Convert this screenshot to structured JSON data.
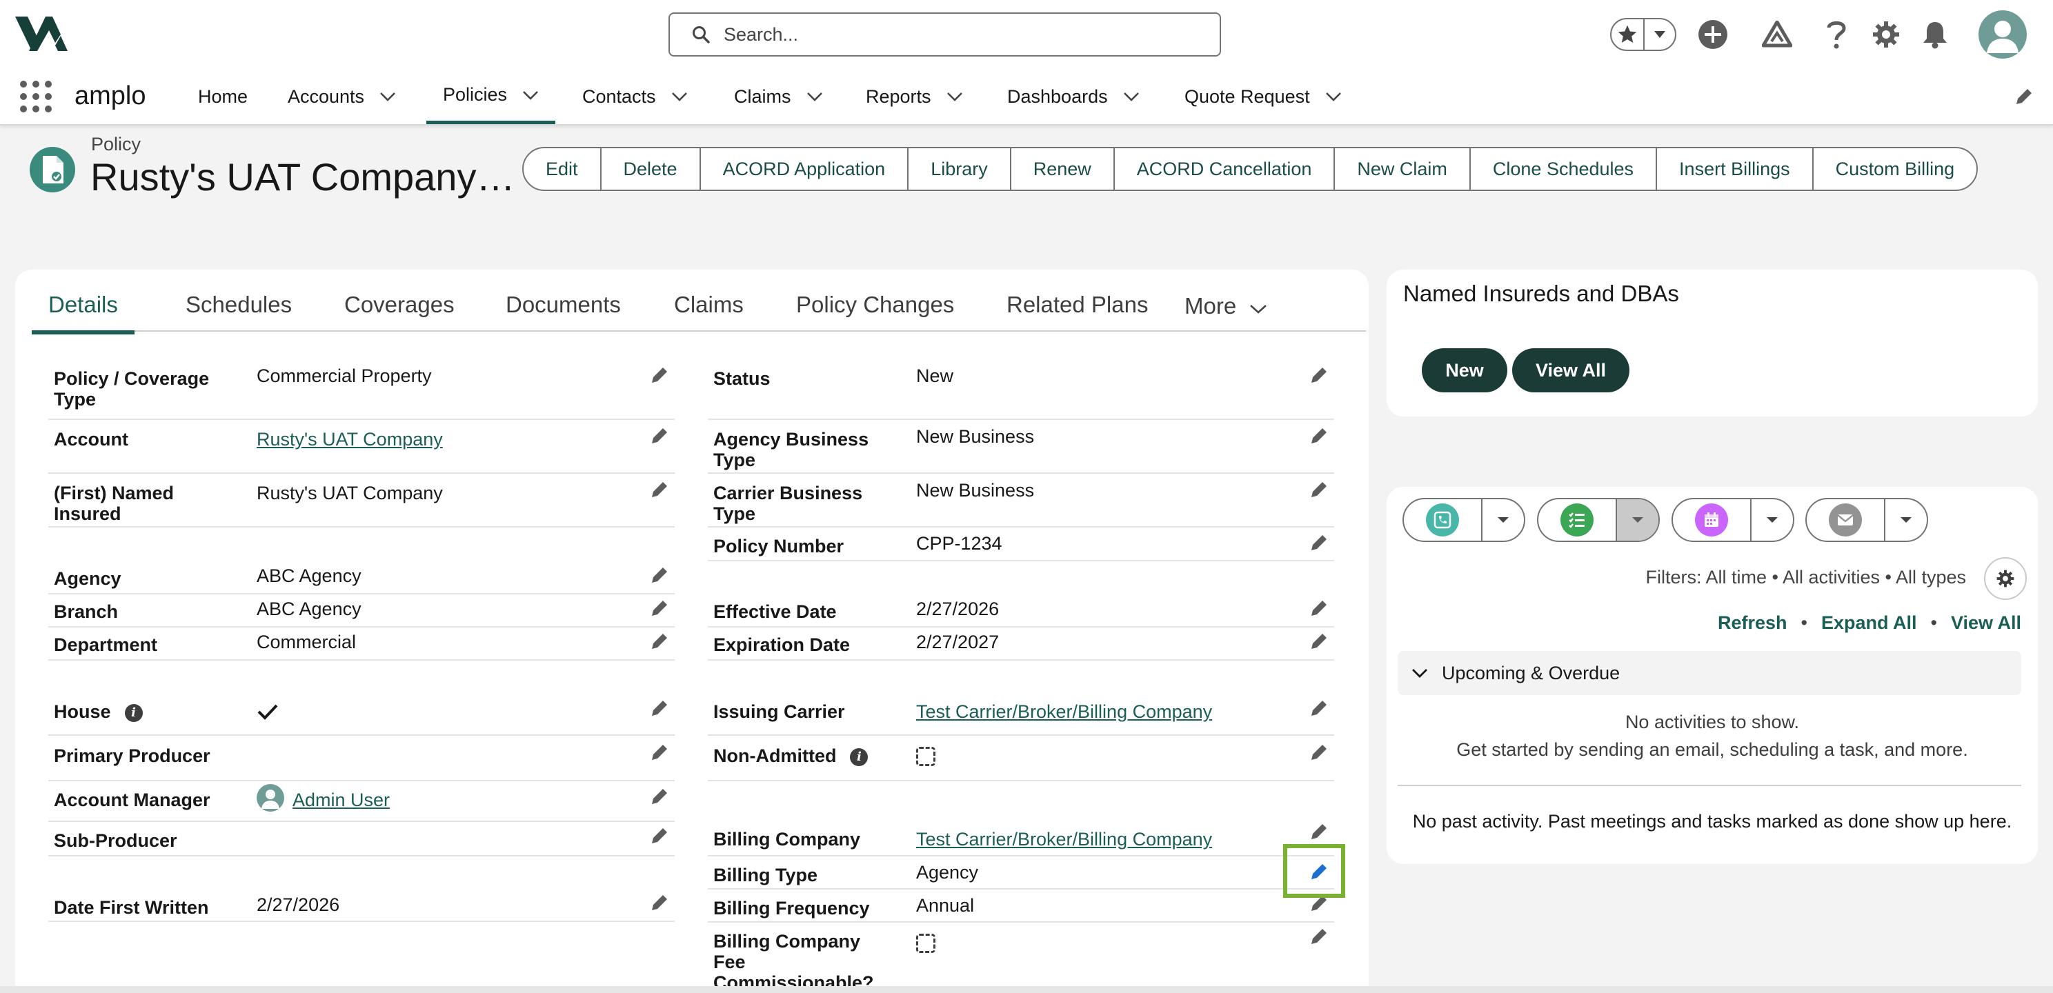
{
  "header": {
    "search_placeholder": "Search...",
    "icons": [
      "star-icon",
      "chevron-down-icon",
      "add-icon",
      "trailhead-icon",
      "help-icon",
      "settings-icon",
      "notification-icon",
      "user-avatar"
    ]
  },
  "nav": {
    "app_name": "amplo",
    "tabs": [
      {
        "label": "Home"
      },
      {
        "label": "Accounts"
      },
      {
        "label": "Policies"
      },
      {
        "label": "Contacts"
      },
      {
        "label": "Claims"
      },
      {
        "label": "Reports"
      },
      {
        "label": "Dashboards"
      },
      {
        "label": "Quote Request"
      }
    ],
    "active_tab": "Policies"
  },
  "record": {
    "type": "Policy",
    "title": "Rusty's UAT Company…",
    "actions": [
      "Edit",
      "Delete",
      "ACORD Application",
      "Library",
      "Renew",
      "ACORD Cancellation",
      "New Claim",
      "Clone Schedules",
      "Insert Billings",
      "Custom Billing"
    ]
  },
  "detail_tabs": [
    "Details",
    "Schedules",
    "Coverages",
    "Documents",
    "Claims",
    "Policy Changes",
    "Related Plans",
    "More"
  ],
  "left_fields": [
    {
      "label": "Policy / Coverage Type",
      "value": "Commercial Property"
    },
    {
      "label": "Account",
      "value": "Rusty's UAT Company"
    },
    {
      "label": "(First) Named Insured",
      "value": "Rusty's UAT Company"
    },
    {
      "label": "Agency",
      "value": "ABC Agency"
    },
    {
      "label": "Branch",
      "value": "ABC Agency"
    },
    {
      "label": "Department",
      "value": "Commercial"
    },
    {
      "label": "House",
      "value": "checked"
    },
    {
      "label": "Primary Producer",
      "value": ""
    },
    {
      "label": "Account Manager",
      "value": "Admin User"
    },
    {
      "label": "Sub-Producer",
      "value": ""
    },
    {
      "label": "Date First Written",
      "value": "2/27/2026"
    }
  ],
  "right_fields": [
    {
      "label": "Status",
      "value": "New"
    },
    {
      "label": "Agency Business Type",
      "value": "New Business"
    },
    {
      "label": "Carrier Business Type",
      "value": "New Business"
    },
    {
      "label": "Policy Number",
      "value": "CPP-1234"
    },
    {
      "label": "Effective Date",
      "value": "2/27/2026"
    },
    {
      "label": "Expiration Date",
      "value": "2/27/2027"
    },
    {
      "label": "Issuing Carrier",
      "value": "Test Carrier/Broker/Billing Company"
    },
    {
      "label": "Non-Admitted",
      "value": "unchecked"
    },
    {
      "label": "Billing Company",
      "value": "Test Carrier/Broker/Billing Company"
    },
    {
      "label": "Billing Type",
      "value": "Agency"
    },
    {
      "label": "Billing Frequency",
      "value": "Annual"
    },
    {
      "label": "Billing Company Fee Commissionable?",
      "value": "unchecked"
    }
  ],
  "named_insureds": {
    "title": "Named Insureds and DBAs",
    "new_label": "New",
    "view_all_label": "View All"
  },
  "activity": {
    "filters": "Filters: All time • All activities • All types",
    "refresh": "Refresh",
    "expand_all": "Expand All",
    "view_all": "View All",
    "upcoming": "Upcoming & Overdue",
    "no_activities": "No activities to show.",
    "get_started": "Get started by sending an email, scheduling a task, and more.",
    "no_past": "No past activity. Past meetings and tasks marked as done show up here."
  },
  "colors": {
    "brand": "#1b5e56",
    "dark_button": "#1b3b36",
    "highlight": "#7bb133",
    "call": "#48b6a9",
    "task": "#3ba755",
    "event": "#cb65ff",
    "email": "#939393"
  }
}
